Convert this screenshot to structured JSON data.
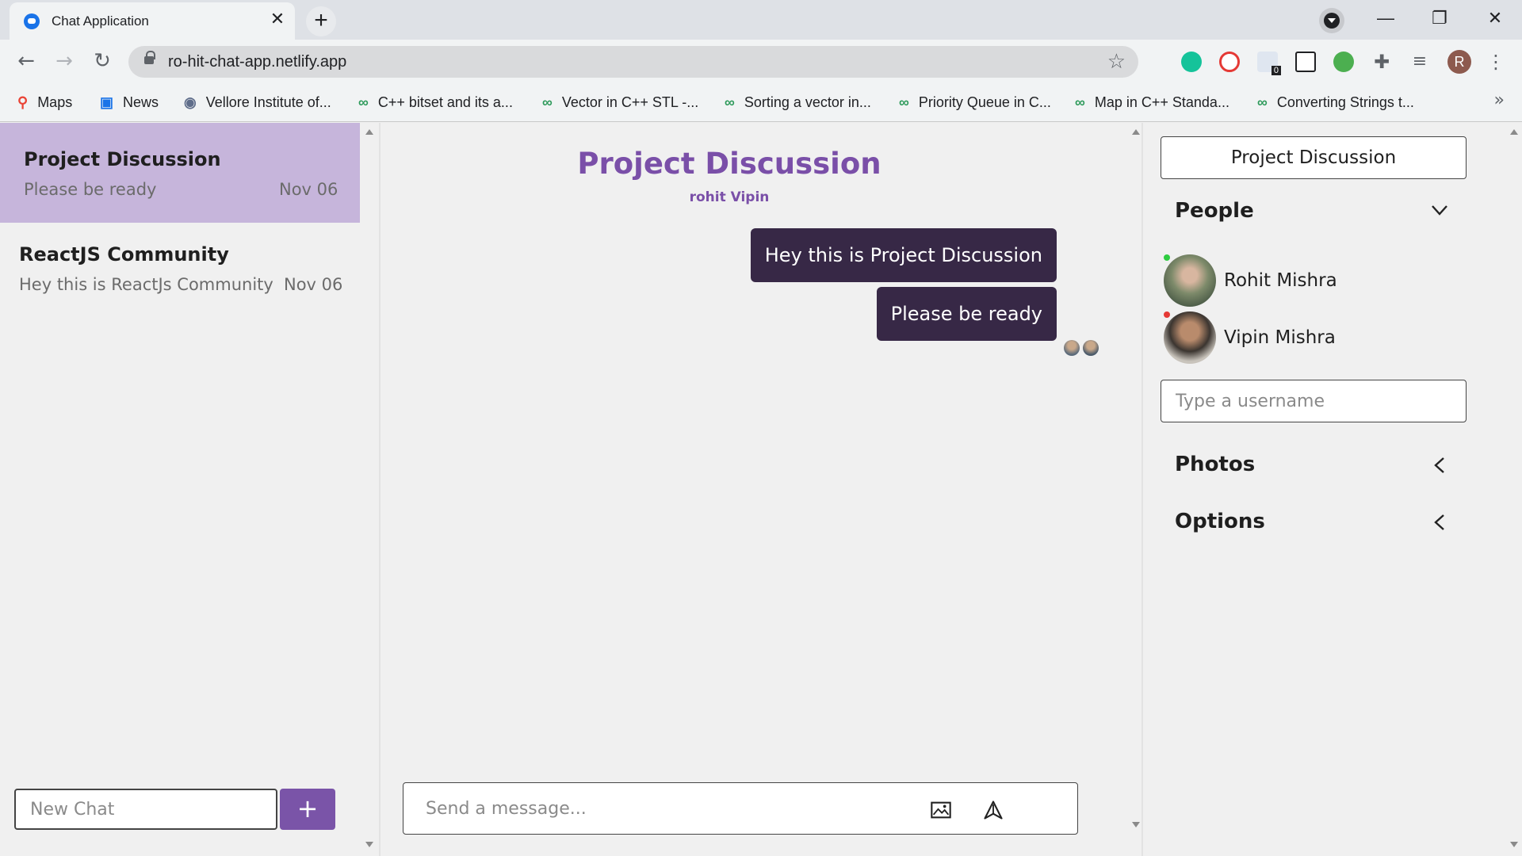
{
  "browser": {
    "tab_title": "Chat Application",
    "url": "ro-hit-chat-app.netlify.app",
    "profile_initial": "R",
    "extension_badge": "0",
    "bookmarks": [
      {
        "label": "Maps",
        "icon": "maps-icon"
      },
      {
        "label": "News",
        "icon": "google-news-icon"
      },
      {
        "label": "Vellore Institute of...",
        "icon": "vit-icon"
      },
      {
        "label": "C++ bitset and its a...",
        "icon": "geeksforgeeks-icon"
      },
      {
        "label": "Vector in C++ STL -...",
        "icon": "geeksforgeeks-icon"
      },
      {
        "label": "Sorting a vector in...",
        "icon": "geeksforgeeks-icon"
      },
      {
        "label": "Priority Queue in C...",
        "icon": "geeksforgeeks-icon"
      },
      {
        "label": "Map in C++ Standa...",
        "icon": "geeksforgeeks-icon"
      },
      {
        "label": "Converting Strings t...",
        "icon": "geeksforgeeks-icon"
      }
    ]
  },
  "sidebar": {
    "chats": [
      {
        "name": "Project Discussion",
        "last_message": "Please be ready",
        "date": "Nov 06",
        "active": true
      },
      {
        "name": "ReactJS Community",
        "last_message": "Hey this is ReactJs Community",
        "date": "Nov 06",
        "active": false
      }
    ],
    "new_chat_placeholder": "New Chat",
    "new_chat_button": "+"
  },
  "chat": {
    "title": "Project Discussion",
    "members": "rohit Vipin",
    "messages": [
      {
        "text": "Hey this is Project Discussion"
      },
      {
        "text": "Please be ready"
      }
    ],
    "message_placeholder": "Send a message..."
  },
  "details": {
    "title": "Project Discussion",
    "people_label": "People",
    "people": [
      {
        "name": "Rohit Mishra",
        "status_color": "#2ecc40"
      },
      {
        "name": "Vipin Mishra",
        "status_color": "#e53935"
      }
    ],
    "username_placeholder": "Type a username",
    "photos_label": "Photos",
    "options_label": "Options"
  },
  "colors": {
    "accent": "#7a54a8",
    "active_chat": "#c6b5db",
    "bubble": "#372846"
  }
}
